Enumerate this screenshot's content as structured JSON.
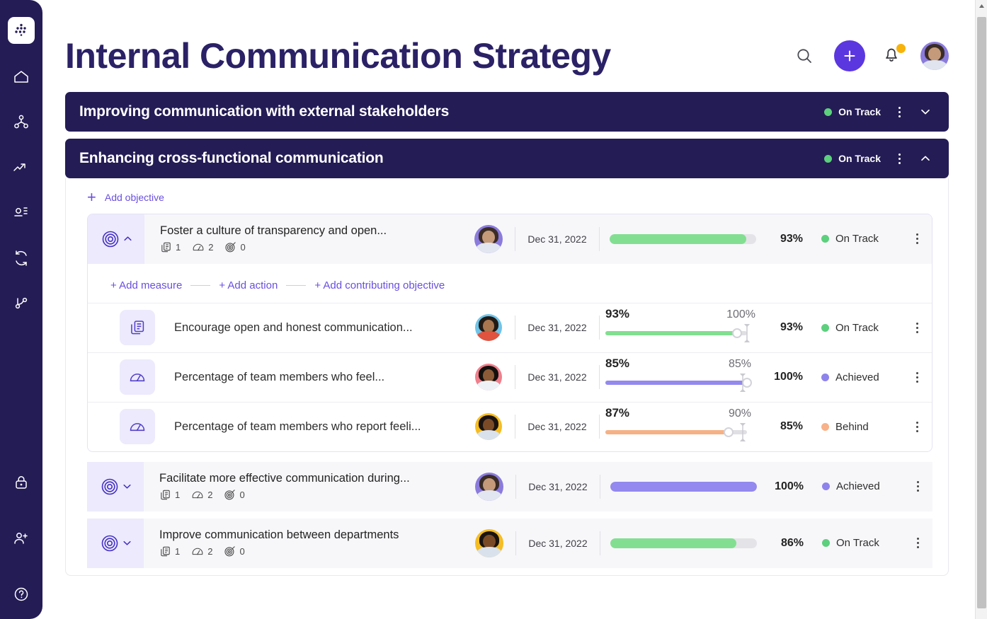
{
  "app": {
    "logo_icon": "grid-dots-logo-icon",
    "accent": "#5b37e0",
    "rail_bg": "#241c55"
  },
  "sidebar": {
    "items": [
      {
        "name": "home",
        "icon": "home-icon"
      },
      {
        "name": "strategy-map",
        "icon": "hierarchy-icon"
      },
      {
        "name": "performance",
        "icon": "trend-up-icon"
      },
      {
        "name": "reports",
        "icon": "presentation-icon"
      },
      {
        "name": "updates",
        "icon": "refresh-icon"
      },
      {
        "name": "workflow",
        "icon": "branch-icon"
      }
    ],
    "bottom_items": [
      {
        "name": "permissions",
        "icon": "lock-icon"
      },
      {
        "name": "invite-user",
        "icon": "user-add-icon"
      },
      {
        "name": "help",
        "icon": "question-circle-icon"
      }
    ]
  },
  "header": {
    "title": "Internal Communication Strategy",
    "search_icon": "search-icon",
    "create_icon": "plus-icon",
    "notifications_icon": "bell-icon",
    "notifications_has_badge": true,
    "avatar_icon": "user-avatar"
  },
  "goals": [
    {
      "title": "Improving communication with external stakeholders",
      "status": "On Track",
      "status_color": "#5cd07d",
      "expanded": false,
      "chevron": "chevron-down-icon"
    },
    {
      "title": "Enhancing cross-functional communication",
      "status": "On Track",
      "status_color": "#5cd07d",
      "expanded": true,
      "chevron": "chevron-up-icon"
    }
  ],
  "panel": {
    "add_objective_label": "Add objective",
    "add_links": [
      "+ Add measure",
      "+ Add action",
      "+ Add contributing objective"
    ]
  },
  "objectives": [
    {
      "name": "Foster a culture of transparency and open...",
      "expanded": true,
      "chevron": "chevron-up-icon",
      "counts": {
        "actions": "1",
        "measures": "2",
        "objectives": "0"
      },
      "owner_avatar": "owner-avatar-1",
      "due_date": "Dec 31, 2022",
      "progress_pct": "93%",
      "progress_value": 93,
      "bar_color": "#82df91",
      "status": "On Track",
      "status_color": "#5cd07d"
    },
    {
      "name": "Facilitate more effective communication during...",
      "expanded": false,
      "chevron": "chevron-down-icon",
      "counts": {
        "actions": "1",
        "measures": "2",
        "objectives": "0"
      },
      "owner_avatar": "owner-avatar-4",
      "due_date": "Dec 31, 2022",
      "progress_pct": "100%",
      "progress_value": 100,
      "bar_color": "#9389ee",
      "status": "Achieved",
      "status_color": "#8e83ec"
    },
    {
      "name": "Improve communication between departments",
      "expanded": false,
      "chevron": "chevron-down-icon",
      "counts": {
        "actions": "1",
        "measures": "2",
        "objectives": "0"
      },
      "owner_avatar": "owner-avatar-5",
      "due_date": "Dec 31, 2022",
      "progress_pct": "86%",
      "progress_value": 86,
      "bar_color": "#82df91",
      "status": "On Track",
      "status_color": "#5cd07d"
    }
  ],
  "measures": [
    {
      "icon": "action-document-icon",
      "name": "Encourage open and honest communication...",
      "owner_avatar": "owner-avatar-2",
      "due_date": "Dec 31, 2022",
      "current_label": "93%",
      "target_label": "100%",
      "current_value": 93,
      "target_value": 100,
      "slider_color": "#82df91",
      "progress_pct": "93%",
      "status": "On Track",
      "status_color": "#5cd07d"
    },
    {
      "icon": "gauge-measure-icon",
      "name": "Percentage of team members who feel...",
      "owner_avatar": "owner-avatar-3",
      "due_date": "Dec 31, 2022",
      "current_label": "85%",
      "target_label": "85%",
      "current_value": 100,
      "target_value": 97,
      "slider_color": "#9389ee",
      "progress_pct": "100%",
      "status": "Achieved",
      "status_color": "#8e83ec"
    },
    {
      "icon": "gauge-measure-icon",
      "name": "Percentage of team members who report feeli...",
      "owner_avatar": "owner-avatar-6",
      "due_date": "Dec 31, 2022",
      "current_label": "87%",
      "target_label": "90%",
      "current_value": 87,
      "target_value": 97,
      "slider_color": "#f5b185",
      "progress_pct": "85%",
      "status": "Behind",
      "status_color": "#f8b189"
    }
  ],
  "scrollbar": {
    "up_arrow": "scroll-up-arrow",
    "position": "top"
  }
}
